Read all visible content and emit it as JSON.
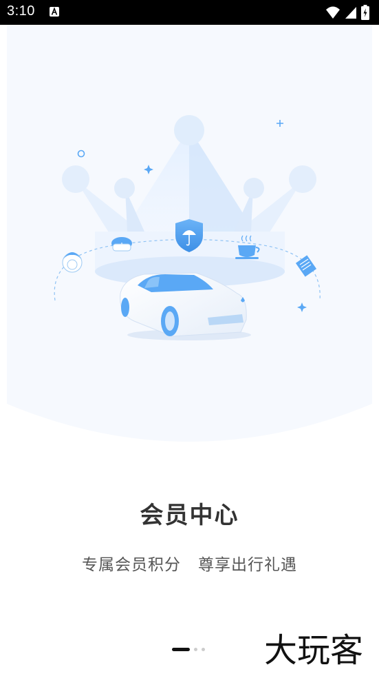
{
  "status_bar": {
    "time": "3:10",
    "notification_icon": "font-a-icon",
    "wifi_icon": "wifi-icon",
    "signal_icon": "cell-signal-icon",
    "battery_icon": "battery-charging-icon"
  },
  "intro": {
    "title": "会员中心",
    "subtitle": "专属会员积分   尊享出行礼遇",
    "page_indicator": {
      "current": 1,
      "total": 3
    }
  },
  "watermark": {
    "text": "大玩客"
  },
  "colors": {
    "accent": "#5aa8f5",
    "hero_bg": "#f6f9fe",
    "title": "#333333",
    "subtitle": "#555555"
  }
}
